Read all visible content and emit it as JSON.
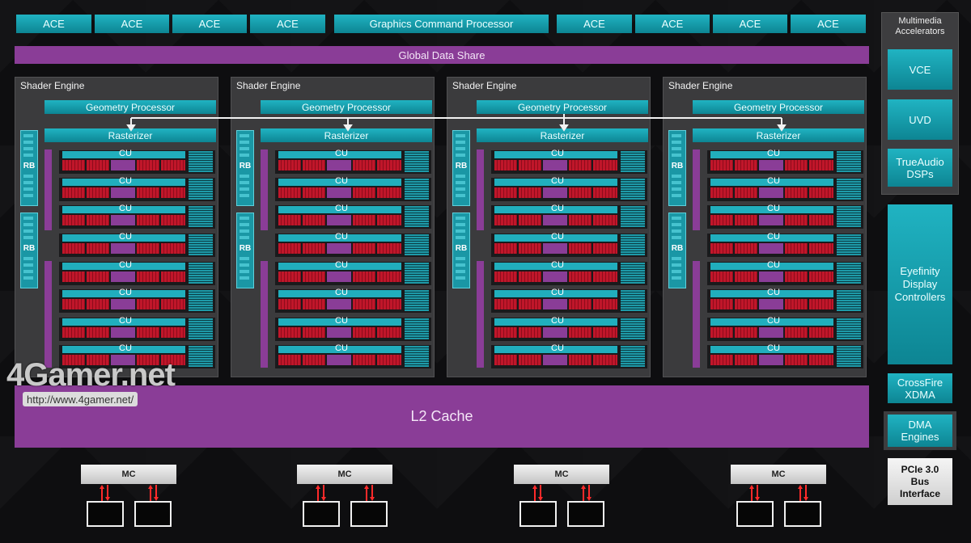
{
  "top_row": {
    "ace_label": "ACE",
    "gcp_label": "Graphics Command Processor"
  },
  "global_data_share": "Global Data Share",
  "shader_engine": {
    "title": "Shader Engine",
    "geometry_label": "Geometry Processor",
    "rasterizer_label": "Rasterizer",
    "rb_label": "RB",
    "cu_label": "CU"
  },
  "l2_cache": "L2 Cache",
  "memory_controller_label": "MC",
  "right_panel": {
    "multimedia_title": "Multimedia\nAccelerators",
    "vce": "VCE",
    "uvd": "UVD",
    "trueaudio": "TrueAudio\nDSPs",
    "eyefinity": "Eyefinity\nDisplay\nControllers",
    "crossfire": "CrossFire\nXDMA",
    "dma": "DMA\nEngines",
    "pcie": "PCIe 3.0\nBus\nInterface"
  },
  "watermark": {
    "logo": "4Gamer.net",
    "url": "http://www.4gamer.net/"
  },
  "colors": {
    "teal": "#1a9fae",
    "purple": "#8a3d97",
    "red": "#c0162a",
    "panel": "#3b3b3d"
  }
}
